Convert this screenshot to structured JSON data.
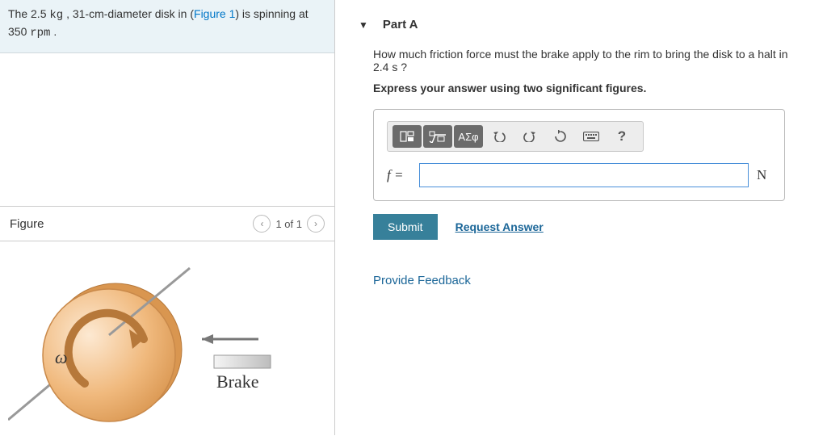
{
  "problem": {
    "pre": "The 2.5 ",
    "m1": "kg",
    "mid1": " , 31-cm-diameter disk in (",
    "figlink": "Figure 1",
    "mid2": ") is spinning at 350 ",
    "m2": "rpm",
    "post": " ."
  },
  "figure": {
    "title": "Figure",
    "counter": "1 of 1",
    "omega": "ω",
    "brake": "Brake"
  },
  "part": {
    "label": "Part A"
  },
  "question": "How much friction force must the brake apply to the rim to bring the disk to a halt in 2.4  s ?",
  "instruction": "Express your answer using two significant figures.",
  "toolbar": {
    "greek": "ΑΣφ",
    "help": "?"
  },
  "answer": {
    "lhs": "f =",
    "value": "",
    "unit": "N"
  },
  "buttons": {
    "submit": "Submit",
    "request": "Request Answer"
  },
  "feedback": "Provide Feedback"
}
